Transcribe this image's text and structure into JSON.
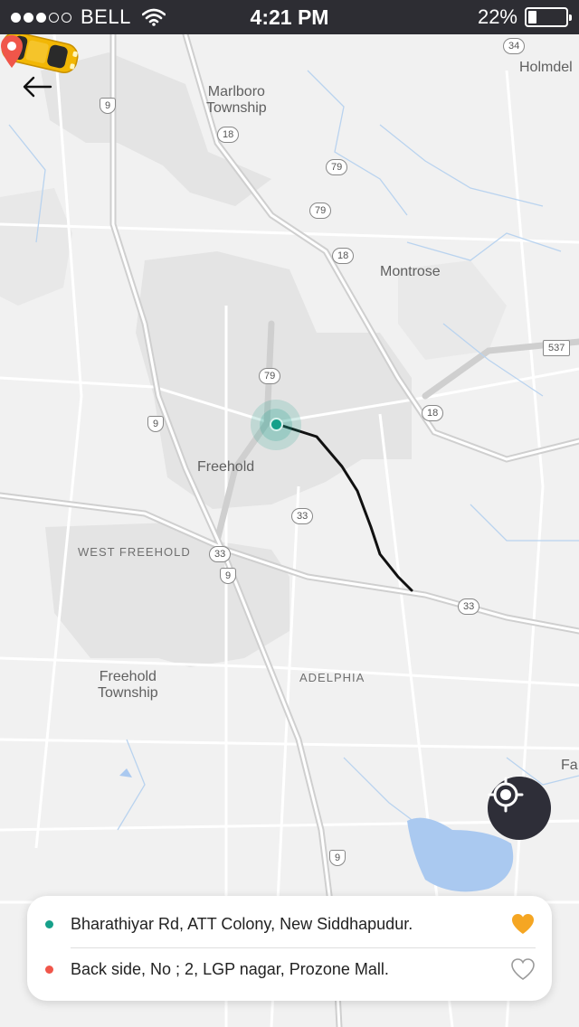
{
  "status_bar": {
    "carrier": "BELL",
    "signal_bars": 5,
    "signal_filled": 3,
    "time": "4:21 PM",
    "battery_text": "22%",
    "battery_level": 0.22
  },
  "map": {
    "place_labels": [
      "Marlboro\nTownship",
      "Montrose",
      "Holmdel",
      "Freehold",
      "WEST FREEHOLD",
      "Freehold\nTownship",
      "ADELPHIA",
      "Fa"
    ],
    "route_shields": [
      "9",
      "18",
      "79",
      "79",
      "18",
      "34",
      "537",
      "79",
      "18",
      "9",
      "33",
      "33",
      "9",
      "33",
      "9"
    ]
  },
  "route": {
    "pickup_address": "Bharathiyar Rd, ATT Colony, New Siddhapudur.",
    "drop_address": "Back side, No ; 2, LGP nagar, Prozone Mall.",
    "pickup_favorite": true,
    "drop_favorite": false
  },
  "colors": {
    "pickup": "#16a08a",
    "drop": "#f0564a",
    "favorite_active": "#f5a623",
    "locate_button": "#2e2e38",
    "status_bar": "#2d2d33"
  },
  "icons": {
    "back": "arrow-left-icon",
    "locate": "crosshair-icon",
    "favorite_on": "heart-filled-icon",
    "favorite_off": "heart-outline-icon",
    "wifi": "wifi-icon",
    "battery": "battery-icon",
    "car": "taxi-car-icon",
    "drop_pin": "map-pin-icon"
  }
}
